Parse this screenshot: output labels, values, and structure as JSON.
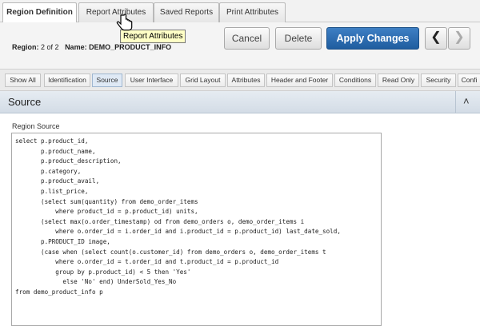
{
  "top_tabs": [
    "Region Definition",
    "Report Attributes",
    "Saved Reports",
    "Print Attributes"
  ],
  "tooltip": "Report Attributes",
  "region_info": {
    "region_label": "Region:",
    "region_value": "2 of 2",
    "name_label": "Name:",
    "name_value": "DEMO_PRODUCT_INFO"
  },
  "buttons": {
    "cancel": "Cancel",
    "delete": "Delete",
    "apply": "Apply Changes",
    "prev": "❮",
    "next": "❯"
  },
  "sub_tabs": [
    "Show All",
    "Identification",
    "Source",
    "User Interface",
    "Grid Layout",
    "Attributes",
    "Header and Footer",
    "Conditions",
    "Read Only",
    "Security",
    "Confi"
  ],
  "section": {
    "title": "Source",
    "collapse_icon": "chevron-up-icon"
  },
  "source": {
    "label": "Region Source",
    "code": "select p.product_id,\n       p.product_name,\n       p.product_description,\n       p.category,\n       p.product_avail,\n       p.list_price,\n       (select sum(quantity) from demo_order_items\n           where product_id = p.product_id) units,\n       (select max(o.order_timestamp) od from demo_orders o, demo_order_items i\n           where o.order_id = i.order_id and i.product_id = p.product_id) last_date_sold,\n       p.PRODUCT_ID image,\n       (case when (select count(o.customer_id) from demo_orders o, demo_order_items t\n           where o.order_id = t.order_id and t.product_id = p.product_id\n           group by p.product_id) < 5 then 'Yes'\n             else 'No' end) UnderSold_Yes_No\nfrom demo_product_info p"
  }
}
